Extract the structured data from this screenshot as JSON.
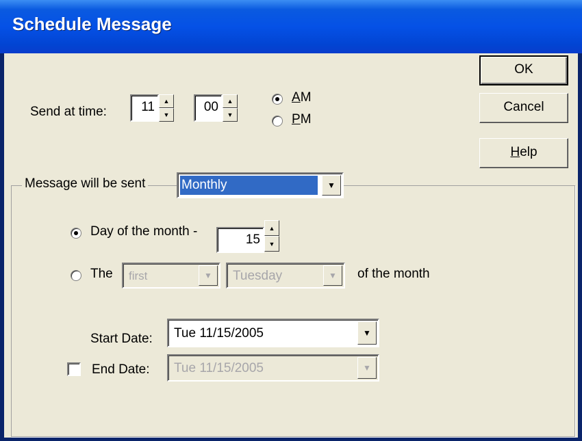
{
  "window": {
    "title": "Schedule Message"
  },
  "time": {
    "label": "Send at time:",
    "hour": "11",
    "minute": "00",
    "am_label": "AM",
    "am_underline": "A",
    "am_rest": "M",
    "pm_label": "PM",
    "pm_underline": "P",
    "pm_rest": "M",
    "selected": "AM"
  },
  "buttons": {
    "ok": "OK",
    "cancel": "Cancel",
    "help_underline": "H",
    "help_rest": "elp"
  },
  "frequency": {
    "group_label": "Message will be sent",
    "selected": "Monthly"
  },
  "monthly": {
    "day_option_label": "Day of the month -",
    "day_value": "15",
    "the_option_label": "The",
    "ordinal": "first",
    "weekday": "Tuesday",
    "suffix": "of the month",
    "selected": "day"
  },
  "dates": {
    "start_label": "Start Date:",
    "start_value": "Tue 11/15/2005",
    "end_label": "End Date:",
    "end_value": "Tue 11/15/2005",
    "end_enabled": false
  },
  "icons": {
    "dropdown": "chevron-down-icon",
    "spin_up": "spin-up-icon",
    "spin_down": "spin-down-icon"
  }
}
